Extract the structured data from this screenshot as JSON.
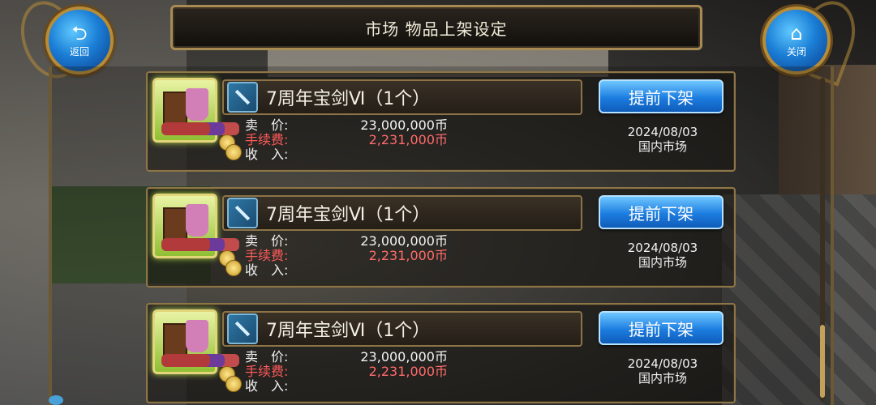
{
  "title": "市场 物品上架设定",
  "buttons": {
    "back_label": "返回",
    "close_label": "关闭",
    "back_icon": "back-arrow-icon",
    "close_icon": "home-icon"
  },
  "listings": [
    {
      "item_name": "7周年宝剑Ⅵ（1个）",
      "sell_price_label": "卖　价:",
      "fee_label": "手续费:",
      "income_label": "收　入:",
      "sell_price_value": "23,000,000币",
      "fee_value": "2,231,000币",
      "income_value": "",
      "action_label": "提前下架",
      "date": "2024/08/03",
      "market": "国内市场"
    },
    {
      "item_name": "7周年宝剑Ⅵ（1个）",
      "sell_price_label": "卖　价:",
      "fee_label": "手续费:",
      "income_label": "收　入:",
      "sell_price_value": "23,000,000币",
      "fee_value": "2,231,000币",
      "income_value": "",
      "action_label": "提前下架",
      "date": "2024/08/03",
      "market": "国内市场"
    },
    {
      "item_name": "7周年宝剑Ⅵ（1个）",
      "sell_price_label": "卖　价:",
      "fee_label": "手续费:",
      "income_label": "收　入:",
      "sell_price_value": "23,000,000币",
      "fee_value": "2,231,000币",
      "income_value": "",
      "action_label": "提前下架",
      "date": "2024/08/03",
      "market": "国内市场"
    }
  ],
  "colors": {
    "accent_blue": "#1c7de0",
    "fee_red": "#ff5a5a",
    "frame_gold": "#a78b53"
  }
}
